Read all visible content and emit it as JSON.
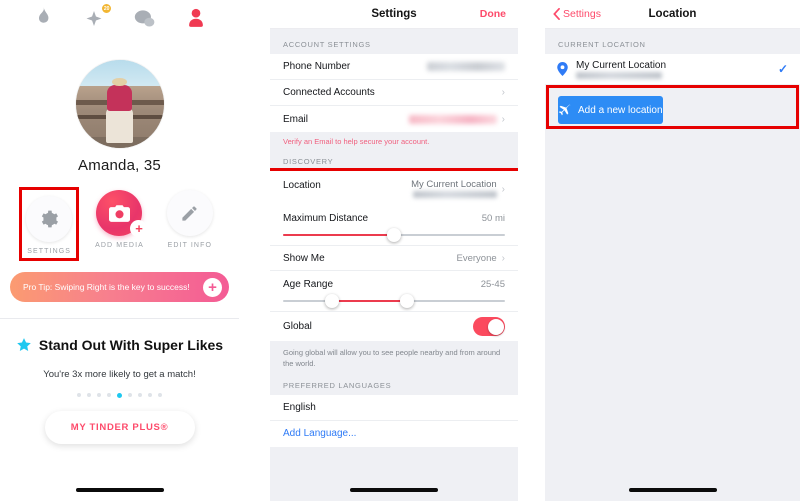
{
  "panels": {
    "profile": {
      "name": "profile-screen",
      "tabs": [
        {
          "icon": "flame-icon",
          "label": "Discover",
          "active": false
        },
        {
          "icon": "sparkle-star-icon",
          "label": "Top Picks",
          "active": false,
          "badge": "20"
        },
        {
          "icon": "chat-bubbles-icon",
          "label": "Messages",
          "active": false
        },
        {
          "icon": "person-icon",
          "label": "Profile",
          "active": true
        }
      ],
      "profile_name": "Amanda, 35",
      "actions": [
        {
          "icon": "gear-icon",
          "label": "SETTINGS",
          "highlighted": true
        },
        {
          "icon": "camera-plus-icon",
          "label": "ADD MEDIA",
          "highlighted": false
        },
        {
          "icon": "pencil-icon",
          "label": "EDIT INFO",
          "highlighted": false
        }
      ],
      "pro_tip": {
        "text": "Pro Tip: Swiping Right is the key to success!",
        "plus_label": "+",
        "gradient_from": "#fb9b71",
        "gradient_to": "#f45b95"
      },
      "promo": {
        "title": "Stand Out With Super Likes",
        "star_color": "#1ec8f0",
        "subtitle": "You're 3x more likely to get a match!",
        "dots_total": 9,
        "dots_active_index": 4,
        "cta_label": "MY TINDER PLUS®",
        "cta_color": "#fd4b6b"
      }
    },
    "settings": {
      "name": "settings-screen",
      "nav": {
        "title": "Settings",
        "right_action": "Done",
        "right_color": "#fd4b6b"
      },
      "sections": [
        {
          "header": "ACCOUNT SETTINGS",
          "rows": [
            {
              "label": "Phone Number",
              "value": "",
              "redacted": "gray",
              "chevron": false
            },
            {
              "label": "Connected Accounts",
              "value": "",
              "redacted": "",
              "chevron": true
            },
            {
              "label": "Email",
              "value": "",
              "redacted": "pink",
              "chevron": true
            }
          ],
          "footnote": "Verify an Email to help secure your account.",
          "footnote_color": "#f0607f"
        },
        {
          "header": "DISCOVERY",
          "rows": [
            {
              "label": "Location",
              "value": "My Current Location",
              "sub_redacted": "Shenzhen, Guangdong",
              "chevron": true,
              "highlighted": true
            },
            {
              "label": "Maximum Distance",
              "value": "50 mi",
              "slider": {
                "percent": 50
              }
            },
            {
              "label": "Show Me",
              "value": "Everyone",
              "chevron": true
            },
            {
              "label": "Age Range",
              "value": "25-45",
              "range_slider": {
                "low": 22,
                "high": 56
              }
            },
            {
              "label": "Global",
              "value": "",
              "toggle_on": true
            }
          ],
          "footnote": "Going global will allow you to see people nearby and from around the world.",
          "footnote_color": "#82878e"
        },
        {
          "header": "PREFERRED LANGUAGES",
          "rows": [
            {
              "label": "English",
              "value": ""
            },
            {
              "label": "Add Language...",
              "value": "",
              "link": true,
              "link_color": "#2f7bf6"
            }
          ]
        }
      ]
    },
    "location": {
      "name": "location-screen",
      "nav": {
        "back_label": "Settings",
        "title": "Location",
        "back_color": "#fd4b6b"
      },
      "section_header": "CURRENT LOCATION",
      "current": {
        "pin_icon": "map-pin-icon",
        "title": "My Current Location",
        "subtitle_redacted": "Shenzhen, Guangdong",
        "selected": true,
        "check_icon": "checkmark-icon",
        "check_color": "#2f7bf6"
      },
      "add_button": {
        "icon": "airplane-icon",
        "label": "Add a new location",
        "color": "#2d8cf5",
        "highlighted": true
      }
    }
  },
  "highlight": {
    "color": "#e60000",
    "width": 3
  }
}
